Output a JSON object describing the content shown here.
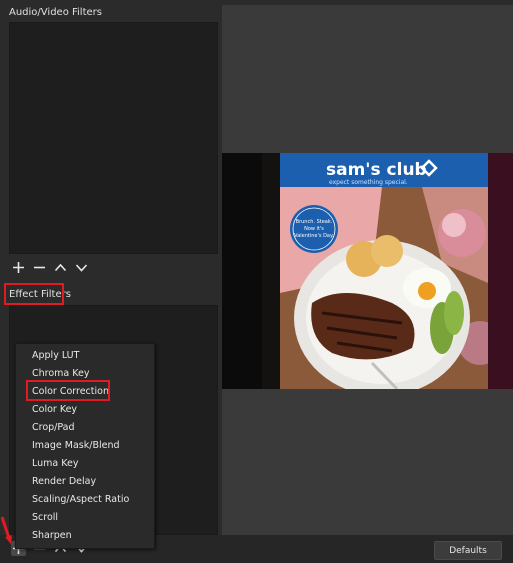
{
  "audio_video_filters": {
    "label": "Audio/Video Filters"
  },
  "effect_filters": {
    "label": "Effect Filters"
  },
  "effect_menu": {
    "items": [
      "Apply LUT",
      "Chroma Key",
      "Color Correction",
      "Color Key",
      "Crop/Pad",
      "Image Mask/Blend",
      "Luma Key",
      "Render Delay",
      "Scaling/Aspect Ratio",
      "Scroll",
      "Sharpen"
    ],
    "highlighted": "Color Correction"
  },
  "preview": {
    "brand": "sam's club",
    "tagline": "expect something special.",
    "badge": "Brunch. Steak. Now it's Valentine's Day."
  },
  "buttons": {
    "defaults": "Defaults"
  },
  "colors": {
    "highlight": "#e01b24",
    "brand_blue": "#1b5fae"
  }
}
